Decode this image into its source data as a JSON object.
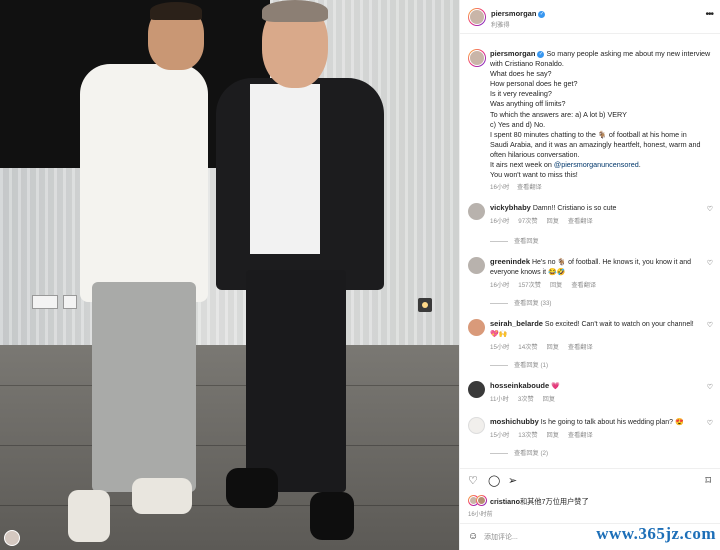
{
  "post": {
    "username": "piersmorgan",
    "verified_icon": "verified-badge-icon",
    "location": "利雅得",
    "caption_lines": [
      "So many people asking me about my new interview",
      "with Cristiano Ronaldo.",
      "What does he say?",
      "How personal does he get?",
      "Is it very revealing?",
      "Was anything off limits?",
      "To which the answers are: a) A lot b) VERY",
      "c) Yes and d) No.",
      "I spent 80 minutes chatting to the 🐐 of football at his home in",
      "Saudi Arabia, and it was an amazingly heartfelt, honest, warm and",
      "often hilarious conversation."
    ],
    "caption_airs": "It airs next week on ",
    "caption_mention": "@piersmorganuncensored",
    "caption_airs_end": ".",
    "caption_last": "You won't want to miss this!",
    "caption_time": "16小时",
    "caption_translate": "查看翻译"
  },
  "comments": [
    {
      "user": "vickybhaby",
      "text": "Damn!! Cristiano is so cute",
      "time": "16小时",
      "likes": "97次赞",
      "reply": "回复",
      "translate": "查看翻译",
      "replies": "查看回复"
    },
    {
      "user": "greenindek",
      "text": "He's no 🐐 of football. He knows it, you know it and everyone knows it 😂🤣",
      "time": "16小时",
      "likes": "157次赞",
      "reply": "回复",
      "translate": "查看翻译",
      "replies": "查看回复 (33)"
    },
    {
      "user": "seirah_belarde",
      "text": "So excited! Can't wait to watch on your channel! 💖🙌",
      "time": "15小时",
      "likes": "14次赞",
      "reply": "回复",
      "translate": "查看翻译",
      "replies": "查看回复 (1)"
    },
    {
      "user": "hosseinkaboude",
      "text": "💗",
      "time": "11小时",
      "likes": "3次赞",
      "reply": "回复",
      "translate": "",
      "replies": ""
    },
    {
      "user": "moshichubby",
      "text": "Is he going to talk about his wedding plan? 😍",
      "time": "15小时",
      "likes": "13次赞",
      "reply": "回复",
      "translate": "查看翻译",
      "replies": "查看回复 (2)"
    }
  ],
  "liked_by": {
    "name": "cristiano",
    "rest": "和其他7万位用户赞了"
  },
  "post_time": "16小时前",
  "comment_input": {
    "placeholder": "添加评论..."
  },
  "watermark": "www.365jz.com",
  "icons": {
    "like": "heart-outline-icon",
    "comment": "comment-bubble-icon",
    "share": "paper-plane-icon",
    "save": "bookmark-icon",
    "more": "more-dots-icon",
    "emoji": "emoji-smile-icon"
  }
}
